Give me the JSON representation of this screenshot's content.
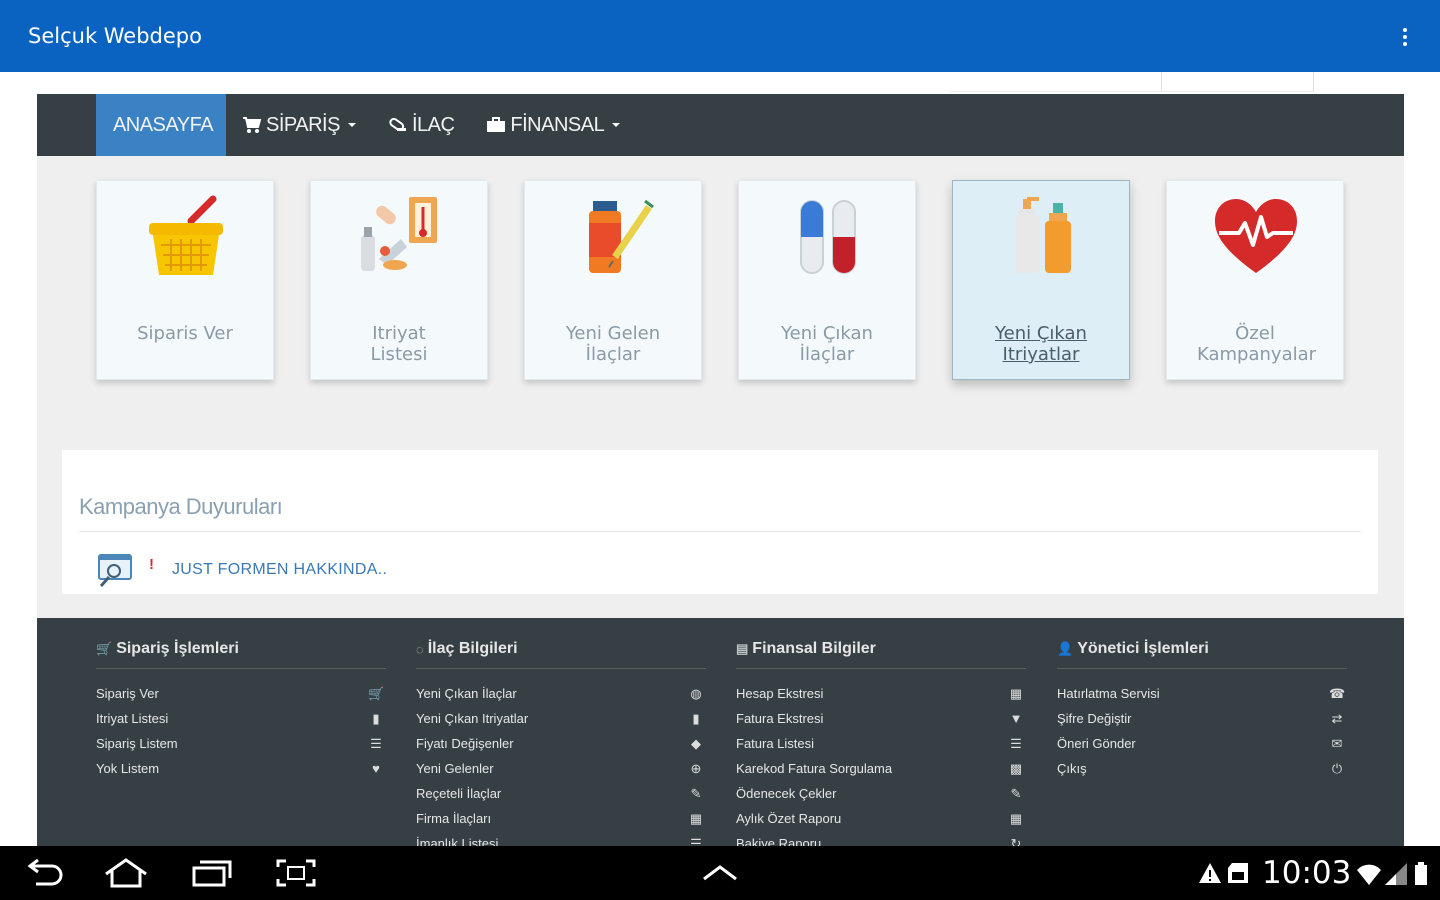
{
  "app": {
    "title": "Selçuk Webdepo"
  },
  "nav": {
    "home": "ANASAYFA",
    "order": "SİPARİŞ",
    "drug": "İLAÇ",
    "finance": "FİNANSAL"
  },
  "tiles": [
    {
      "label": "Siparis Ver",
      "icon": "shopping-basket-icon"
    },
    {
      "label": "Itriyat Listesi",
      "icon": "cosmetics-icon"
    },
    {
      "label": "Yeni Gelen İlaçlar",
      "icon": "medicine-bottle-icon"
    },
    {
      "label": "Yeni Çıkan İlaçlar",
      "icon": "capsule-icon"
    },
    {
      "label": "Yeni Çıkan Itriyatlar",
      "icon": "lotion-bottles-icon"
    },
    {
      "label": "Özel Kampanyalar",
      "icon": "heartbeat-icon"
    }
  ],
  "campaigns": {
    "title": "Kampanya Duyuruları",
    "items": [
      {
        "mark": "!",
        "text": "JUST FORMEN HAKKINDA.."
      }
    ]
  },
  "footer": {
    "columns": [
      {
        "title": "Sipariş İşlemleri",
        "items": [
          {
            "label": "Sipariş Ver",
            "icon": "cart-icon"
          },
          {
            "label": "Itriyat Listesi",
            "icon": "bottle-icon"
          },
          {
            "label": "Sipariş Listem",
            "icon": "list-icon"
          },
          {
            "label": "Yok Listem",
            "icon": "heart-icon"
          }
        ]
      },
      {
        "title": "İlaç Bilgileri",
        "items": [
          {
            "label": "Yeni Çıkan İlaçlar",
            "icon": "pill-icon"
          },
          {
            "label": "Yeni Çıkan Itriyatlar",
            "icon": "bottle-icon"
          },
          {
            "label": "Fiyatı Değişenler",
            "icon": "tag-icon"
          },
          {
            "label": "Yeni Gelenler",
            "icon": "plus-circle-icon"
          },
          {
            "label": "Reçeteli İlaçlar",
            "icon": "edit-icon"
          },
          {
            "label": "Firma İlaçları",
            "icon": "grid-icon"
          },
          {
            "label": "İmanlık Listesi",
            "icon": "list-icon"
          }
        ]
      },
      {
        "title": "Finansal Bilgiler",
        "items": [
          {
            "label": "Hesap Ekstresi",
            "icon": "calendar-icon"
          },
          {
            "label": "Fatura Ekstresi",
            "icon": "bookmark-icon"
          },
          {
            "label": "Fatura Listesi",
            "icon": "list-icon"
          },
          {
            "label": "Karekod Fatura Sorgulama",
            "icon": "qrcode-icon"
          },
          {
            "label": "Ödenecek Çekler",
            "icon": "edit-icon"
          },
          {
            "label": "Aylık Özet Raporu",
            "icon": "grid-icon"
          },
          {
            "label": "Bakiye Raporu",
            "icon": "refresh-icon"
          }
        ]
      },
      {
        "title": "Yönetici İşlemleri",
        "items": [
          {
            "label": "Hatırlatma Servisi",
            "icon": "phone-icon"
          },
          {
            "label": "Şifre Değiştir",
            "icon": "retweet-icon"
          },
          {
            "label": "Öneri Gönder",
            "icon": "envelope-icon"
          },
          {
            "label": "Çıkış",
            "icon": "power-icon"
          }
        ]
      }
    ]
  },
  "system": {
    "time": "10:03"
  }
}
